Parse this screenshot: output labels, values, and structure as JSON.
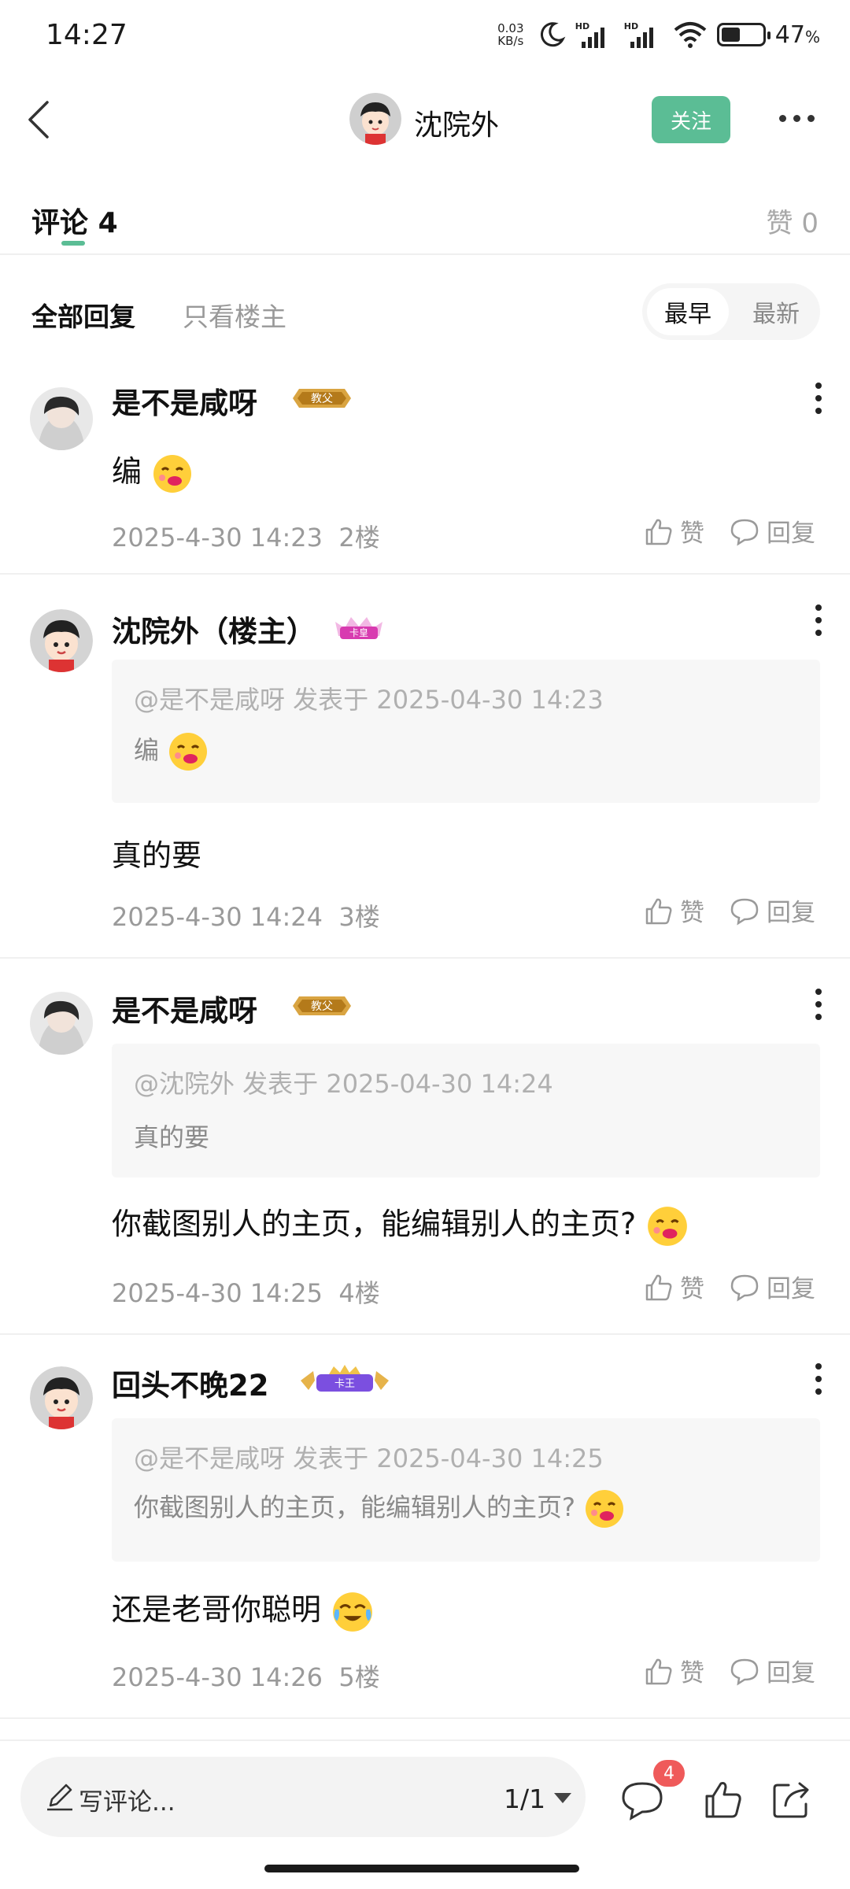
{
  "status_bar": {
    "time": "14:27",
    "net_speed_value": "0.03",
    "net_speed_unit": "KB/s",
    "battery_percent": "47",
    "battery_unit": "%",
    "battery_level": 0.47,
    "hd_label": "HD"
  },
  "header": {
    "title": "沈院外",
    "follow_label": "关注"
  },
  "tabs": {
    "comments_label": "评论",
    "comments_count": "4",
    "likes_label": "赞",
    "likes_count": "0"
  },
  "filters": {
    "all_label": "全部回复",
    "host_only_label": "只看楼主",
    "sort_earliest": "最早",
    "sort_newest": "最新"
  },
  "comments": [
    {
      "name": "是不是咸呀",
      "badge": "教父",
      "text": "编",
      "time": "2025-4-30 14:23",
      "floor": "2楼",
      "like_label": "赞",
      "reply_label": "回复"
    },
    {
      "name": "沈院外（楼主）",
      "badge": "卡皇",
      "quote_header": "@是不是咸呀 发表于 2025-04-30 14:23",
      "quote_text": "编",
      "text": "真的要",
      "time": "2025-4-30 14:24",
      "floor": "3楼",
      "like_label": "赞",
      "reply_label": "回复"
    },
    {
      "name": "是不是咸呀",
      "badge": "教父",
      "quote_header": "@沈院外 发表于 2025-04-30 14:24",
      "quote_text": "真的要",
      "text": "你截图别人的主页，能编辑别人的主页?",
      "time": "2025-4-30 14:25",
      "floor": "4楼",
      "like_label": "赞",
      "reply_label": "回复"
    },
    {
      "name": "回头不晚22",
      "badge": "卡王",
      "quote_header": "@是不是咸呀 发表于 2025-04-30 14:25",
      "quote_text": "你截图别人的主页，能编辑别人的主页?",
      "text": "还是老哥你聪明",
      "time": "2025-4-30 14:26",
      "floor": "5楼",
      "like_label": "赞",
      "reply_label": "回复"
    }
  ],
  "bottom_bar": {
    "placeholder": "写评论...",
    "page_indicator": "1/1",
    "comment_count": "4"
  },
  "colors": {
    "accent_green": "#5bbd95",
    "badge_red": "#ef5a5a",
    "muted_text": "#9a9a9a"
  }
}
